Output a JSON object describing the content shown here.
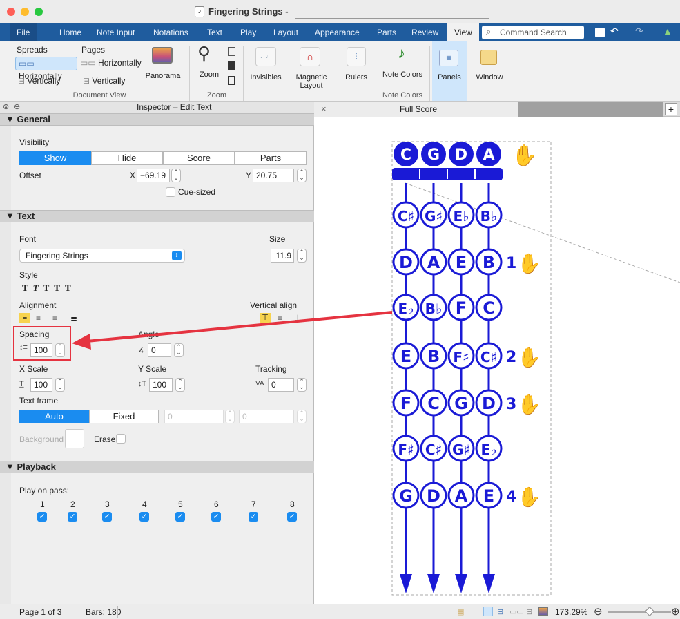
{
  "window": {
    "title": "Fingering Strings -",
    "app_icon": "music-doc-icon"
  },
  "ribbon_tabs": [
    "File",
    "Home",
    "Note Input",
    "Notations",
    "Text",
    "Play",
    "Layout",
    "Appearance",
    "Parts",
    "Review",
    "View"
  ],
  "command_search": {
    "placeholder": "Command Search"
  },
  "ribbon": {
    "spreads_label": "Spreads",
    "pages_label": "Pages",
    "spreads_horizontally": "Horizontally",
    "spreads_vertically": "Vertically",
    "pages_horizontally": "Horizontally",
    "pages_vertically": "Vertically",
    "panorama": "Panorama",
    "document_view": "Document View",
    "zoom": "Zoom",
    "zoom_group": "Zoom",
    "invisibles": "Invisibles",
    "magnetic_layout": "Magnetic Layout",
    "rulers": "Rulers",
    "note_colors": "Note Colors",
    "note_colors_group": "Note Colors",
    "panels": "Panels",
    "window": "Window"
  },
  "inspector": {
    "title": "Inspector – Edit Text",
    "general": "General",
    "visibility": "Visibility",
    "vis_options": [
      "Show",
      "Hide",
      "Score",
      "Parts"
    ],
    "offset": "Offset",
    "x_label": "X",
    "x_value": "−69.19",
    "y_label": "Y",
    "y_value": "20.75",
    "cue_sized": "Cue-sized",
    "text": "Text",
    "font": "Font",
    "font_value": "Fingering Strings",
    "size": "Size",
    "size_value": "11.9",
    "style": "Style",
    "alignment": "Alignment",
    "vertical_align": "Vertical align",
    "spacing": "Spacing",
    "spacing_value": "100",
    "angle": "Angle",
    "angle_value": "0",
    "x_scale": "X Scale",
    "x_scale_value": "100",
    "y_scale": "Y Scale",
    "y_scale_value": "100",
    "tracking": "Tracking",
    "tracking_value": "0",
    "text_frame": "Text frame",
    "frame_auto": "Auto",
    "frame_fixed": "Fixed",
    "frame_w": "0",
    "frame_h": "0",
    "background": "Background",
    "erase": "Erase",
    "playback": "Playback",
    "play_on_pass": "Play on pass:",
    "passes": [
      "1",
      "2",
      "3",
      "4",
      "5",
      "6",
      "7",
      "8"
    ]
  },
  "score": {
    "tab_title": "Full Score",
    "open_strings": [
      "C",
      "G",
      "D",
      "A"
    ],
    "rows": [
      {
        "notes": [
          "C♯",
          "G♯",
          "E♭",
          "B♭"
        ],
        "finger": ""
      },
      {
        "notes": [
          "D",
          "A",
          "E",
          "B"
        ],
        "finger": "1"
      },
      {
        "notes": [
          "E♭",
          "B♭",
          "F",
          "C"
        ],
        "finger": ""
      },
      {
        "notes": [
          "E",
          "B",
          "F♯",
          "C♯"
        ],
        "finger": "2"
      },
      {
        "notes": [
          "F",
          "C",
          "G",
          "D"
        ],
        "finger": "3"
      },
      {
        "notes": [
          "F♯",
          "C♯",
          "G♯",
          "E♭"
        ],
        "finger": ""
      },
      {
        "notes": [
          "G",
          "D",
          "A",
          "E"
        ],
        "finger": "4"
      }
    ],
    "ink_color": "#1a1ad6"
  },
  "status": {
    "page": "Page 1 of 3",
    "bars": "Bars: 180",
    "zoom": "173.29%"
  }
}
